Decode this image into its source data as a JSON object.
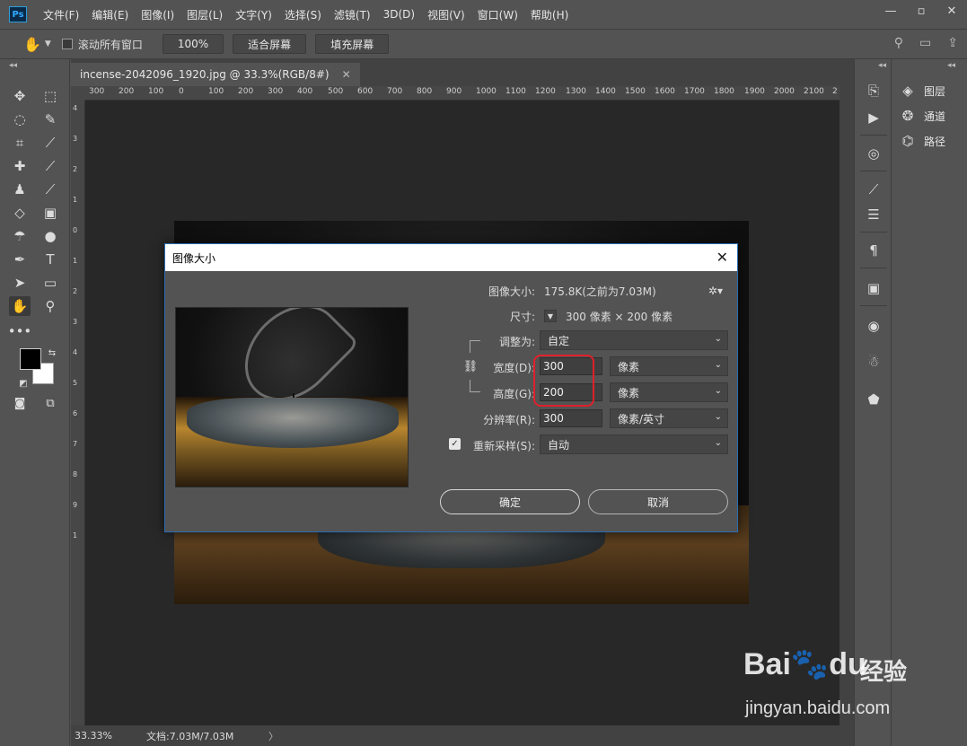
{
  "app": {
    "logo": "Ps"
  },
  "menu": [
    "文件(F)",
    "编辑(E)",
    "图像(I)",
    "图层(L)",
    "文字(Y)",
    "选择(S)",
    "滤镜(T)",
    "3D(D)",
    "视图(V)",
    "窗口(W)",
    "帮助(H)"
  ],
  "window_controls": {
    "minimize": "—",
    "restore": "▫",
    "close": "✕"
  },
  "options_bar": {
    "scroll_all_label": "滚动所有窗口",
    "btn_100": "100%",
    "btn_fit": "适合屏幕",
    "btn_fill": "填充屏幕"
  },
  "document": {
    "tab_title": "incense-2042096_1920.jpg @ 33.3%(RGB/8#)",
    "tab_close": "✕"
  },
  "ruler": {
    "top_ticks": [
      "300",
      "200",
      "100",
      "0",
      "100",
      "200",
      "300",
      "400",
      "500",
      "600",
      "700",
      "800",
      "900",
      "1000",
      "1100",
      "1200",
      "1300",
      "1400",
      "1500",
      "1600",
      "1700",
      "1800",
      "1900",
      "2000",
      "2100",
      "2"
    ],
    "left_ticks": [
      "4",
      "3",
      "2",
      "1",
      "0",
      "1",
      "2",
      "3",
      "4",
      "5",
      "6",
      "7",
      "8",
      "9",
      "1"
    ]
  },
  "status": {
    "zoom": "33.33%",
    "doc_info": "文档:7.03M/7.03M",
    "arrow": "〉"
  },
  "panels": {
    "layers": "图层",
    "channels": "通道",
    "paths": "路径"
  },
  "dialog": {
    "title": "图像大小",
    "image_size_label": "图像大小:",
    "image_size_value": "175.8K(之前为7.03M)",
    "dimensions_label": "尺寸:",
    "dimensions_value": "300 像素 × 200 像素",
    "fit_to_label": "调整为:",
    "fit_to_value": "自定",
    "width_label": "宽度(D):",
    "width_value": "300",
    "width_unit": "像素",
    "height_label": "高度(G):",
    "height_value": "200",
    "height_unit": "像素",
    "resolution_label": "分辨率(R):",
    "resolution_value": "300",
    "resolution_unit": "像素/英寸",
    "resample_label": "重新采样(S):",
    "resample_value": "自动",
    "resample_checked": true,
    "ok": "确定",
    "cancel": "取消"
  },
  "watermark": {
    "brand": "Bai",
    "brand2": "du",
    "product": "经验",
    "url": "jingyan.baidu.com"
  },
  "colors": {
    "accent_highlight": "#e0202a",
    "dialog_border": "#2a6db4"
  }
}
